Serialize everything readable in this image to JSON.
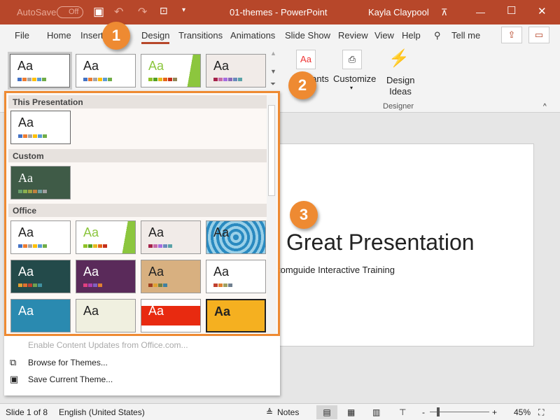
{
  "titlebar": {
    "autosave": "AutoSave",
    "toggle": "Off",
    "doc_title": "01-themes - PowerPoint",
    "user": "Kayla Claypool"
  },
  "tabs": [
    "File",
    "Home",
    "Insert",
    "Design",
    "Transitions",
    "Animations",
    "Slide Show",
    "Review",
    "View",
    "Help"
  ],
  "tell_me": "Tell me",
  "ribbon": {
    "variants_label": "Variants",
    "customize_label": "Customize",
    "design_ideas_label": "Design Ideas",
    "designer_group": "Designer"
  },
  "gallery": {
    "sections": [
      "This Presentation",
      "Custom",
      "Office"
    ],
    "thumb_text": "Aa"
  },
  "menu": {
    "enable_updates": "Enable Content Updates from Office.com...",
    "browse": "Browse for Themes...",
    "save": "Save Current Theme..."
  },
  "slide": {
    "title": "Great Presentation",
    "subtitle": "tomguide Interactive Training"
  },
  "callouts": [
    "1",
    "2",
    "3"
  ],
  "status": {
    "slide": "Slide 1 of 8",
    "language": "English (United States)",
    "notes": "Notes",
    "zoom": "45%",
    "zoom_level_percent": 45
  },
  "colors": {
    "accent": "#b7472a",
    "callout": "#ee8a32"
  }
}
